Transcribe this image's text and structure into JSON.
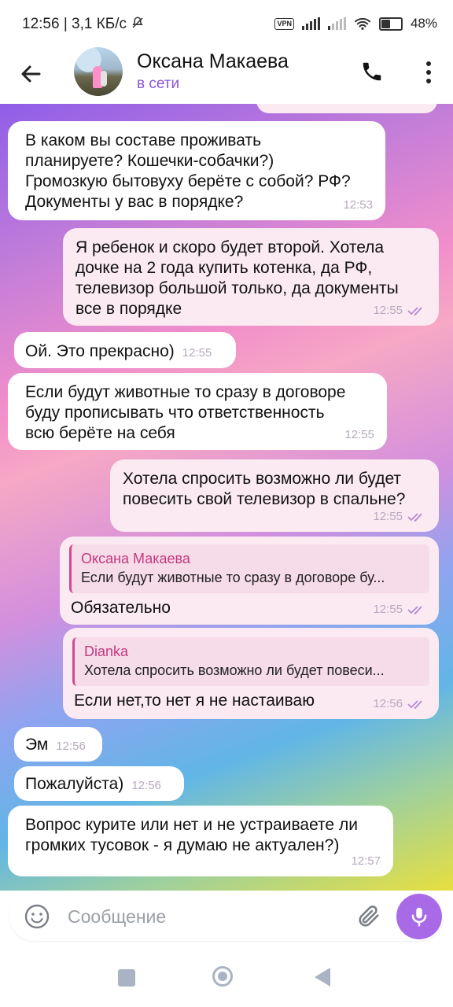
{
  "status_bar": {
    "time": "12:56",
    "speed": "| 3,1 КБ/с",
    "vpn": "VPN",
    "battery": "48%"
  },
  "header": {
    "contact_name": "Оксана Макаева",
    "status": "в сети",
    "icons": [
      "back-arrow-icon",
      "avatar",
      "phone-icon",
      "more-vert-icon"
    ]
  },
  "messages": [
    {
      "dir": "in",
      "text": "В каком вы составе проживать\nпланируете? Кошечки-собачки?)\nГромозкую бытовуху берёте с собой? РФ?\nДокументы у вас в порядке?",
      "time": "12:53"
    },
    {
      "dir": "out",
      "text": "Я ребенок и скоро будет второй. Хотела\nдочке на 2 года купить котенка, да РФ,\nтелевизор большой только, да документы\nвсе в порядке",
      "time": "12:55",
      "read": true
    },
    {
      "dir": "in",
      "text": "Ой. Это прекрасно)",
      "time": "12:55"
    },
    {
      "dir": "in",
      "text": "Если будут животные то сразу в договоре\nбуду прописывать что ответственность\nвсю берёте на себя",
      "time": "12:55"
    },
    {
      "dir": "out",
      "text": "Хотела спросить возможно ли будет\nповесить свой телевизор в спальне?",
      "time": "12:55",
      "read": true
    },
    {
      "dir": "out",
      "reply_name": "Оксана Макаева",
      "reply_text": "Если будут животные то сразу в договоре бу...",
      "text": "Обязательно",
      "time": "12:55",
      "read": true
    },
    {
      "dir": "out",
      "reply_name": "Dianka",
      "reply_text": "Хотела спросить возможно ли будет повеси...",
      "text": "Если нет,то нет я не настаиваю",
      "time": "12:56",
      "read": true
    },
    {
      "dir": "in",
      "text": "Эм",
      "time": "12:56"
    },
    {
      "dir": "in",
      "text": "Пожалуйста)",
      "time": "12:56"
    },
    {
      "dir": "in",
      "text": "Вопрос курите или нет и не устраиваете ли\nгромких тусовок - я думаю не актуален?)",
      "time": "12:57"
    }
  ],
  "composer": {
    "placeholder": "Сообщение",
    "icons": [
      "emoji-icon",
      "attach-icon",
      "mic-icon"
    ]
  },
  "colors": {
    "accent": "#a86ae6",
    "online": "#8a55d6",
    "reply_bar": "#d04b92",
    "outgoing_bubble": "#fbeaf2"
  }
}
